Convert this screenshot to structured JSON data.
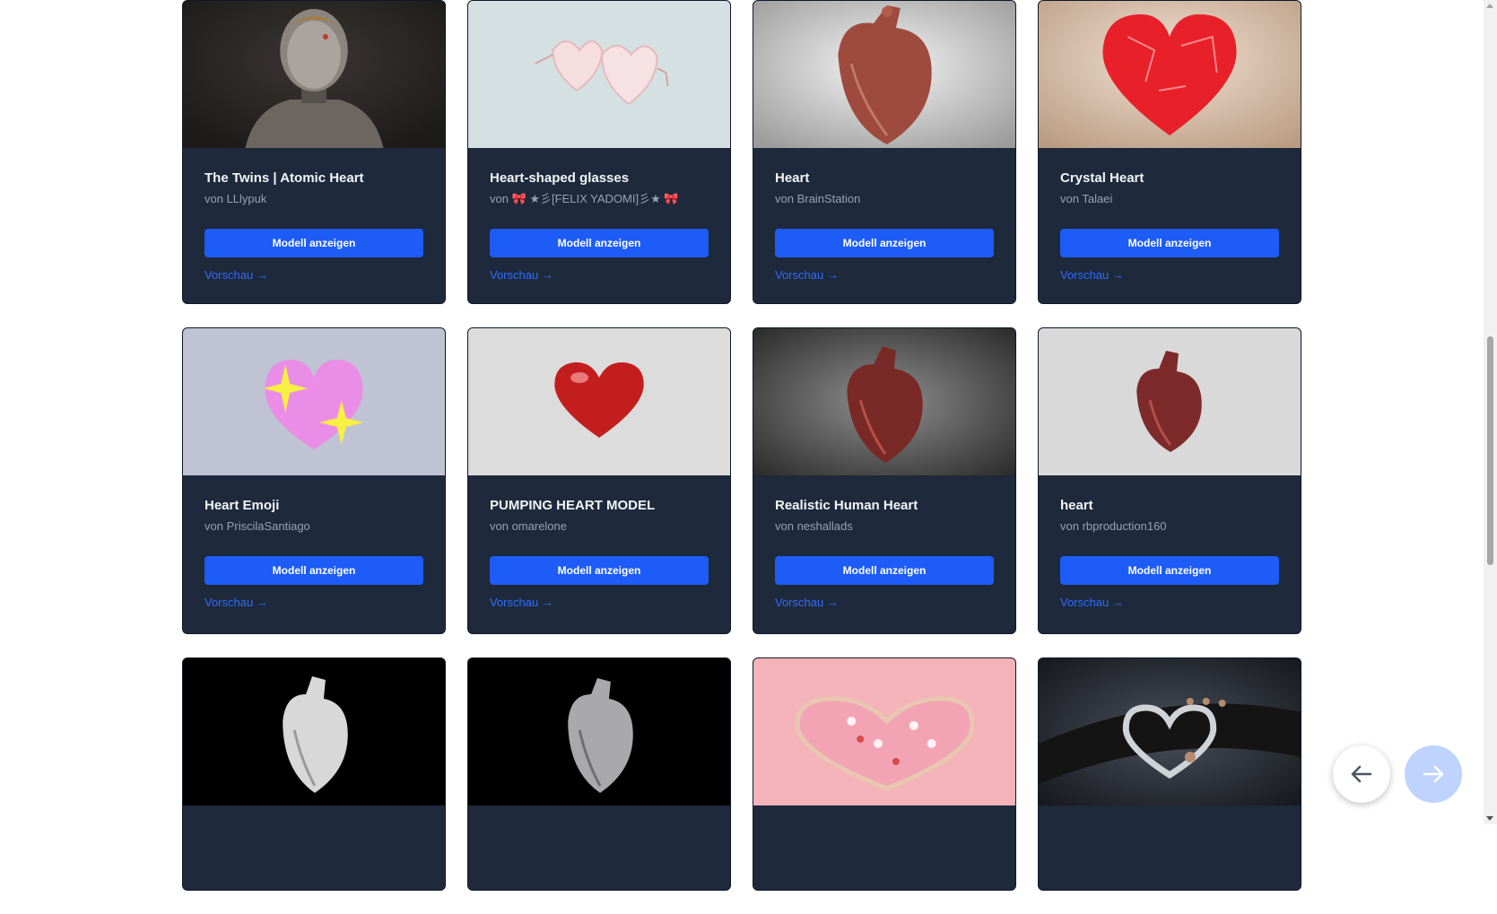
{
  "cards": [
    {
      "title": "The Twins | Atomic Heart",
      "author": "von LLlypuk",
      "button": "Modell anzeigen",
      "preview": "Vorschau →"
    },
    {
      "title": "Heart-shaped glasses",
      "author": "von 🎀 ★彡[FELIX YADOMI]彡★ 🎀",
      "button": "Modell anzeigen",
      "preview": "Vorschau →"
    },
    {
      "title": "Heart",
      "author": "von BrainStation",
      "button": "Modell anzeigen",
      "preview": "Vorschau →"
    },
    {
      "title": "Crystal Heart",
      "author": "von Talaei",
      "button": "Modell anzeigen",
      "preview": "Vorschau →"
    },
    {
      "title": "Heart Emoji",
      "author": "von PriscilaSantiago",
      "button": "Modell anzeigen",
      "preview": "Vorschau →"
    },
    {
      "title": "PUMPING HEART MODEL",
      "author": "von omarelone",
      "button": "Modell anzeigen",
      "preview": "Vorschau →"
    },
    {
      "title": "Realistic Human Heart",
      "author": "von neshallads",
      "button": "Modell anzeigen",
      "preview": "Vorschau →"
    },
    {
      "title": "heart",
      "author": "von rbproduction160",
      "button": "Modell anzeigen",
      "preview": "Vorschau →"
    }
  ],
  "nav": {
    "prev_icon": "arrow-left-icon",
    "next_icon": "arrow-right-icon"
  },
  "colors": {
    "card_bg": "#1e293b",
    "button": "#1d5cf6",
    "link": "#2f6dff",
    "next_button": "#bfd3ff"
  }
}
